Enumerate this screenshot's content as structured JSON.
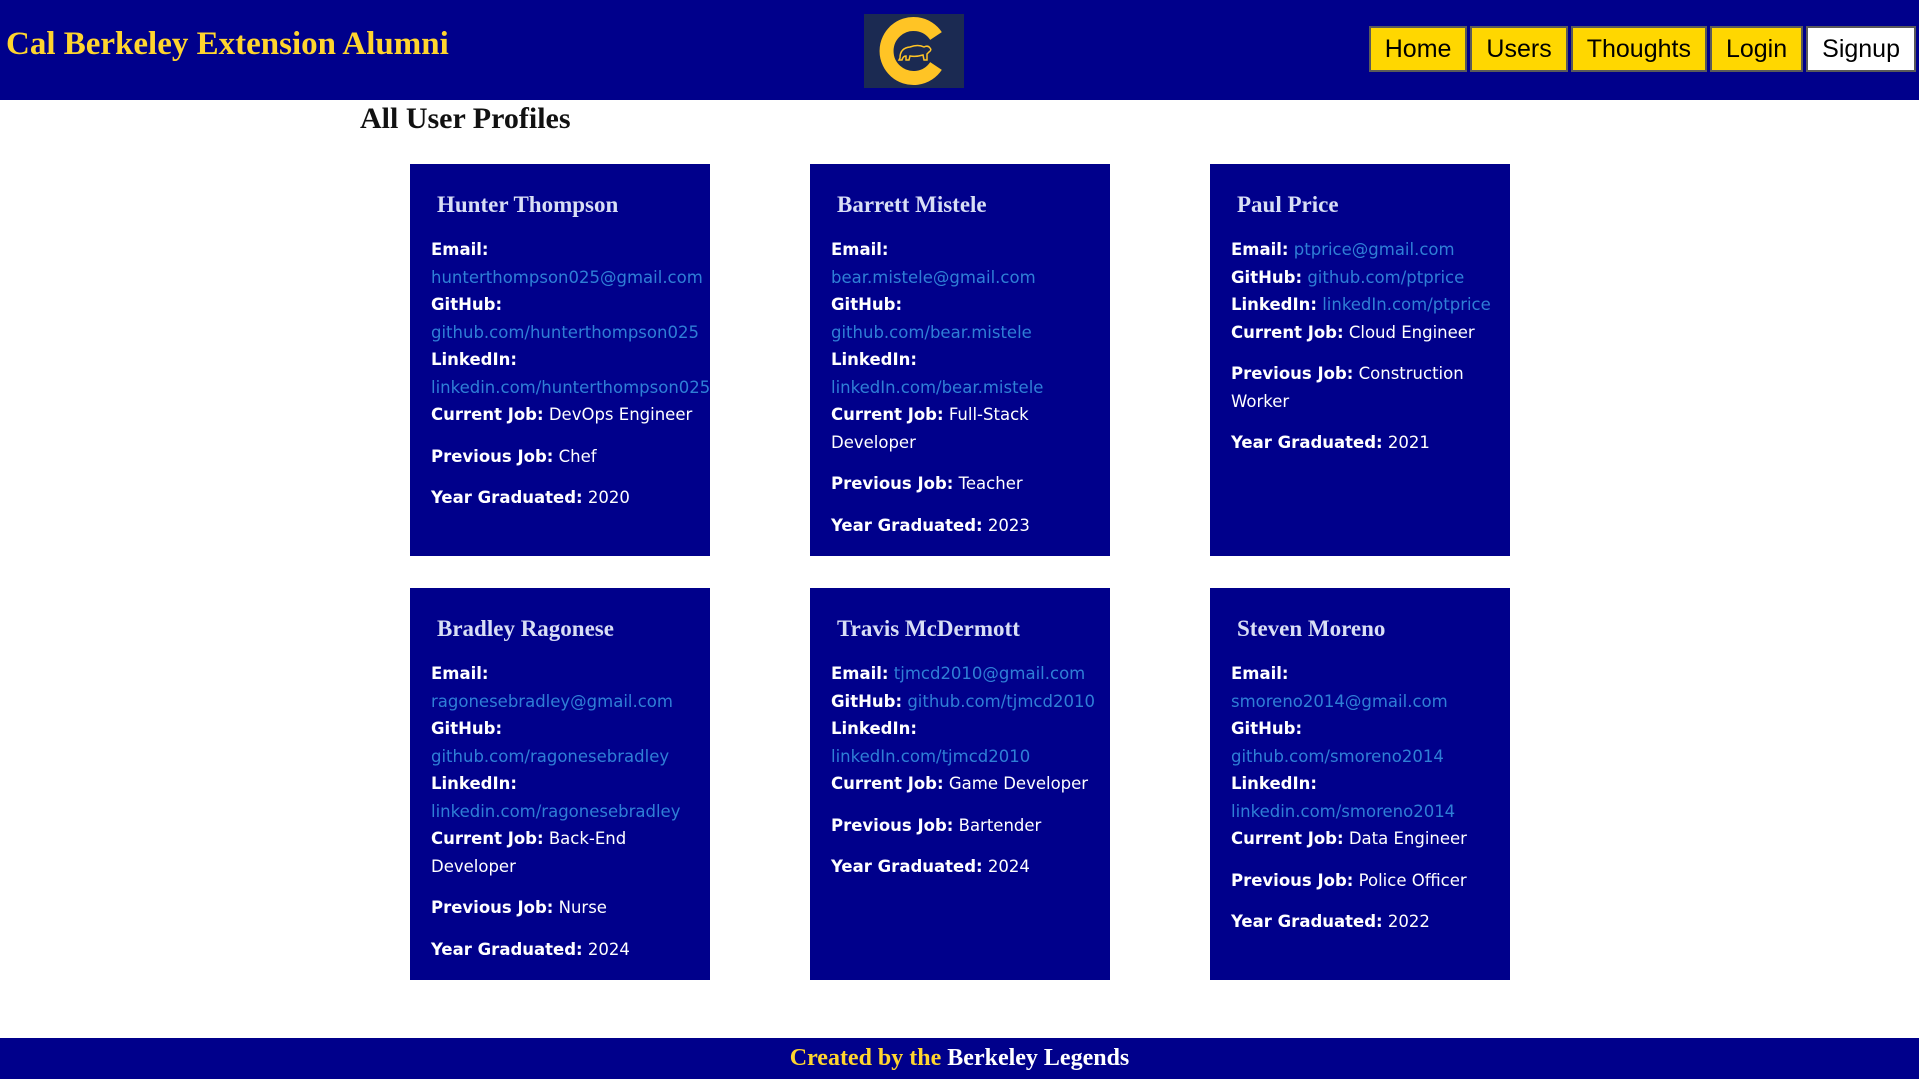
{
  "header": {
    "title": "Cal Berkeley Extension Alumni",
    "logo_icon": "cal-bear-logo",
    "nav": [
      {
        "label": "Home"
      },
      {
        "label": "Users"
      },
      {
        "label": "Thoughts"
      },
      {
        "label": "Login"
      },
      {
        "label": "Signup"
      }
    ]
  },
  "main": {
    "heading": "All User Profiles",
    "field_labels": {
      "email": "Email:",
      "github": "GitHub:",
      "linkedin": "LinkedIn:",
      "current_job": "Current Job:",
      "previous_job": "Previous Job:",
      "year": "Year Graduated:"
    },
    "users": [
      {
        "name": "Hunter Thompson",
        "email": "hunterthompson025@gmail.com",
        "github": "github.com/hunterthompson025",
        "linkedin": "linkedin.com/hunterthompson025",
        "current_job": "DevOps Engineer",
        "previous_job": "Chef",
        "year": "2020"
      },
      {
        "name": "Barrett Mistele",
        "email": "bear.mistele@gmail.com",
        "github": "github.com/bear.mistele",
        "linkedin": "linkedIn.com/bear.mistele",
        "current_job": "Full-Stack Developer",
        "previous_job": "Teacher",
        "year": "2023"
      },
      {
        "name": "Paul Price",
        "email": "ptprice@gmail.com",
        "github": "github.com/ptprice",
        "linkedin": "linkedIn.com/ptprice",
        "current_job": "Cloud Engineer",
        "previous_job": "Construction Worker",
        "year": "2021"
      },
      {
        "name": "Bradley Ragonese",
        "email": "ragonesebradley@gmail.com",
        "github": "github.com/ragonesebradley",
        "linkedin": "linkedin.com/ragonesebradley",
        "current_job": "Back-End Developer",
        "previous_job": "Nurse",
        "year": "2024"
      },
      {
        "name": "Travis McDermott",
        "email": "tjmcd2010@gmail.com",
        "github": "github.com/tjmcd2010",
        "linkedin": "linkedIn.com/tjmcd2010",
        "current_job": "Game Developer",
        "previous_job": "Bartender",
        "year": "2024"
      },
      {
        "name": "Steven Moreno",
        "email": "smoreno2014@gmail.com",
        "github": "github.com/smoreno2014",
        "linkedin": "linkedin.com/smoreno2014",
        "current_job": "Data Engineer",
        "previous_job": "Police Officer",
        "year": "2022"
      }
    ]
  },
  "footer": {
    "part1": "Created by the",
    "part2": "Berkeley Legends"
  },
  "colors": {
    "navy": "#00008b",
    "gold": "#ffd700",
    "link": "#2f7fd6"
  }
}
